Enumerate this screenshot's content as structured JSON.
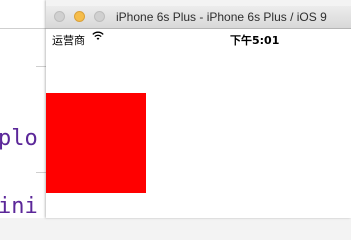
{
  "editor": {
    "lines": [
      "plo",
      "ini"
    ]
  },
  "simulator": {
    "title": "iPhone 6s Plus - iPhone 6s Plus / iOS 9",
    "status_bar": {
      "carrier": "运营商",
      "wifi_icon": "wifi-icon",
      "time": "下午5:01"
    },
    "view": {
      "color": "#ff0000"
    }
  }
}
